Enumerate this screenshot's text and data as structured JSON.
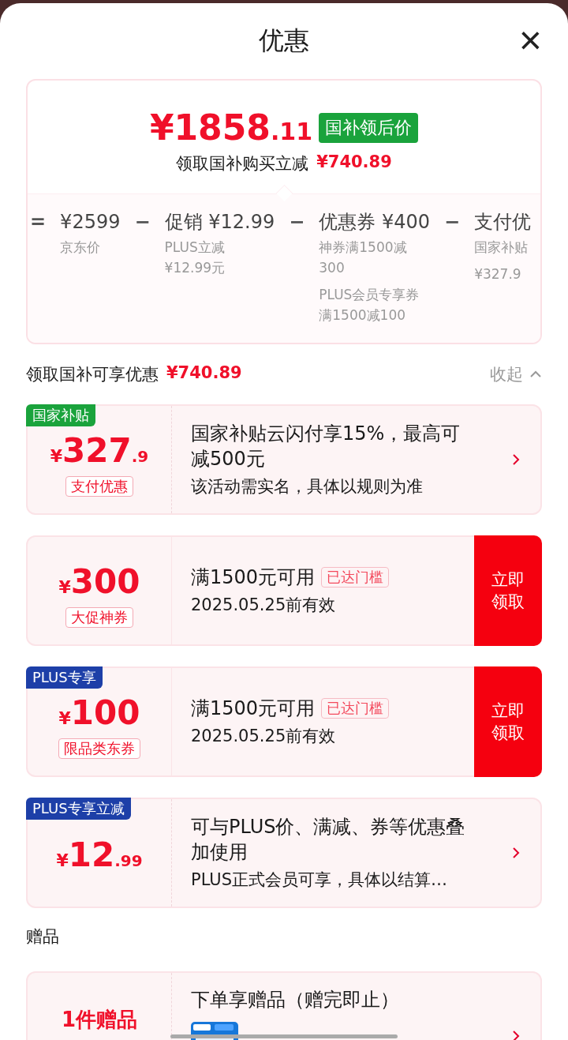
{
  "sheet": {
    "title": "优惠",
    "close": "×"
  },
  "summary": {
    "price_int": "¥1858",
    "price_dec": ".11",
    "price_badge": "国补领后价",
    "saving_label": "领取国补购买立减",
    "saving_value": "¥740.89",
    "breakdown": [
      {
        "operator": "=",
        "amount": "¥2599",
        "notes": [
          "京东价"
        ]
      },
      {
        "operator": "−",
        "amount": "促销 ¥12.99",
        "notes": [
          "PLUS立减¥12.99元"
        ]
      },
      {
        "operator": "−",
        "amount": "优惠券 ¥400",
        "notes": [
          "神券满1500减300",
          "PLUS会员专享券",
          "满1500减100"
        ]
      },
      {
        "operator": "−",
        "amount": "支付优",
        "notes": [
          "国家补贴",
          "¥327.9"
        ]
      }
    ]
  },
  "section": {
    "title": "领取国补可享优惠",
    "value": "¥740.89",
    "toggle": "收起",
    "expanded": true
  },
  "offers": [
    {
      "kind": "arrow",
      "tag": "国家补贴",
      "color": "#1aa33c",
      "currency": "¥",
      "amount": "327",
      "decimal": ".9",
      "label": "支付优惠",
      "title": "国家补贴云闪付享15%，最高可减500元",
      "subtitle": "该活动需实名，具体以规则为准"
    },
    {
      "kind": "claim",
      "currency": "¥",
      "amount": "300",
      "label": "大促神券",
      "title": "满1500元可用",
      "badge": "已达门槛",
      "subtitle": "2025.05.25前有效",
      "action": "立即领取"
    },
    {
      "kind": "claim",
      "tag": "PLUS专享",
      "color": "#1d3fa8",
      "currency": "¥",
      "amount": "100",
      "label": "限品类东券",
      "title": "满1500元可用",
      "badge": "已达门槛",
      "subtitle": "2025.05.25前有效",
      "action": "立即领取"
    },
    {
      "kind": "arrow",
      "tag": "PLUS专享立减",
      "color": "#1d3fa8",
      "currency": "¥",
      "amount": "12",
      "decimal": ".99",
      "title": "可与PLUS价、满减、券等优惠叠加使用",
      "subtitle": "PLUS正式会员可享，具体以结算…"
    }
  ],
  "gifts": {
    "title": "赠品",
    "card": {
      "count": "1件赠品",
      "title": "下单享赠品（赠完即止）",
      "kind": "picture"
    }
  }
}
